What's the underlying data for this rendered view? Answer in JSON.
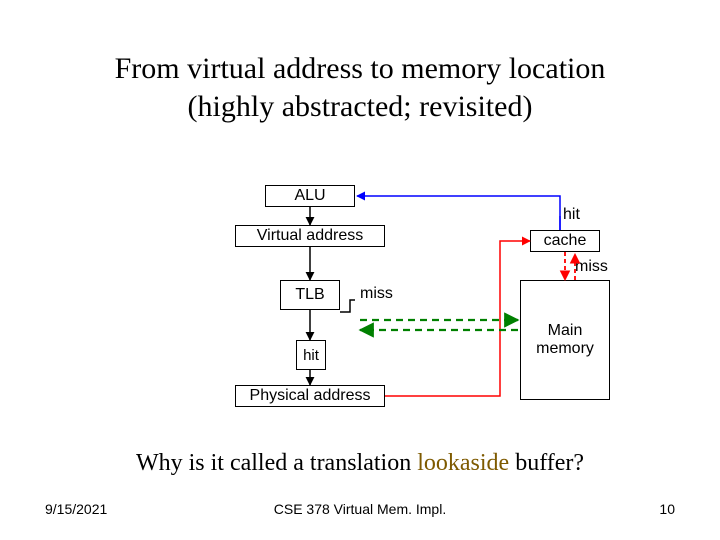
{
  "title_line1": "From virtual address to memory location",
  "title_line2": "(highly abstracted; revisited)",
  "boxes": {
    "alu": "ALU",
    "vaddr": "Virtual address",
    "tlb": "TLB",
    "hit_below_tlb": "hit",
    "paddr": "Physical address",
    "cache": "cache",
    "main_memory_l1": "Main",
    "main_memory_l2": "memory"
  },
  "labels": {
    "hit_top": "hit",
    "miss_tlb": "miss",
    "miss_cache": "miss"
  },
  "question": {
    "before": "Why is it called a translation ",
    "word": "lookaside",
    "after": " buffer?"
  },
  "footer": {
    "date": "9/15/2021",
    "center": "CSE 378 Virtual Mem. Impl.",
    "page": "10"
  },
  "colors": {
    "blue": "#0000ff",
    "red": "#ff0000",
    "green": "#008000",
    "lookaside": "#7e5a00"
  }
}
